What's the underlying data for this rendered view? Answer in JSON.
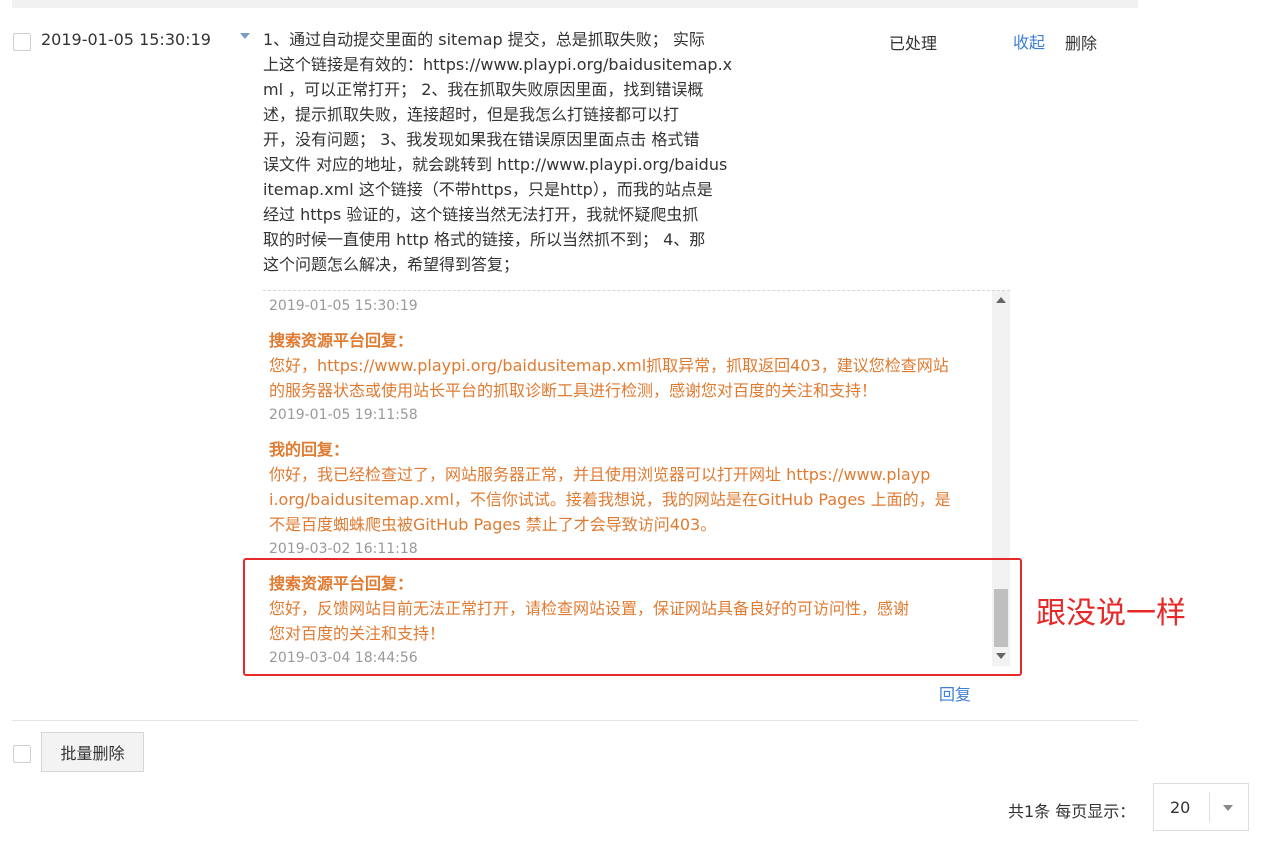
{
  "row": {
    "time": "2019-01-05 15:30:19",
    "content_lines": [
      "1、通过自动提交里面的 sitemap 提交，总是抓取失败； 实际",
      "上这个链接是有效的：https://www.playpi.org/baidusitemap.x",
      "ml ，可以正常打开； 2、我在抓取失败原因里面，找到错误概",
      "述，提示抓取失败，连接超时，但是我怎么打链接都可以打",
      "开，没有问题； 3、我发现如果我在错误原因里面点击 格式错",
      "误文件 对应的地址，就会跳转到 http://www.playpi.org/baidus",
      "itemap.xml 这个链接（不带https，只是http），而我的站点是",
      "经过 https 验证的，这个链接当然无法打开，我就怀疑爬虫抓",
      "取的时候一直使用 http 格式的链接，所以当然抓不到； 4、那",
      "这个问题怎么解决，希望得到答复；"
    ],
    "status": "已处理",
    "collapse_label": "收起",
    "delete_label": "删除"
  },
  "replies": {
    "first_time": "2019-01-05 15:30:19",
    "items": [
      {
        "title": "搜索资源平台回复：",
        "lines": [
          "您好，https://www.playpi.org/baidusitemap.xml抓取异常，抓取返回403，建议您检查网站",
          "的服务器状态或使用站长平台的抓取诊断工具进行检测，感谢您对百度的关注和支持！"
        ],
        "time": "2019-01-05 19:11:58"
      },
      {
        "title": "我的回复：",
        "lines": [
          "你好，我已经检查过了，网站服务器正常，并且使用浏览器可以打开网址 https://www.playp",
          "i.org/baidusitemap.xml，不信你试试。接着我想说，我的网站是在GitHub Pages 上面的，是",
          "不是百度蜘蛛爬虫被GitHub Pages 禁止了才会导致访问403。"
        ],
        "time": "2019-03-02 16:11:18"
      },
      {
        "title": "搜索资源平台回复：",
        "lines": [
          "您好，反馈网站目前无法正常打开，请检查网站设置，保证网站具备良好的可访问性，感谢",
          "您对百度的关注和支持！"
        ],
        "time": "2019-03-04 18:44:56"
      }
    ],
    "reply_label": "回复"
  },
  "annotation": "跟没说一样",
  "footer": {
    "batch_delete_label": "批量删除",
    "total_text": "共1条 每页显示：",
    "page_size": "20"
  },
  "colors": {
    "link": "#3d7fd6",
    "reply_text": "#e07b32",
    "annotation": "#e62a2a"
  }
}
